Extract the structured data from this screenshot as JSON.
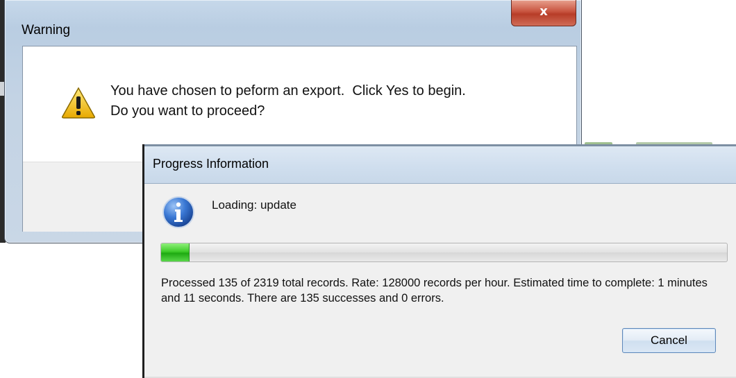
{
  "warning_dialog": {
    "title": "Warning",
    "close_label": "x",
    "message": "You have chosen to peform an export.  Click Yes to begin.\nDo you want to proceed?",
    "icon": "warning-triangle-icon"
  },
  "progress_dialog": {
    "title": "Progress Information",
    "status": "Loading: update",
    "icon": "info-icon",
    "progress_fraction": 0.049,
    "details": "Processed 135 of 2319 total records. Rate: 128000 records per hour. Estimated time to complete: 1 minutes and 11 seconds.  There are 135 successes and 0 errors.",
    "cancel_label": "Cancel"
  },
  "colors": {
    "progress_fill": "#3fcc2a",
    "close_button": "#c8543f",
    "warning_yellow": "#f2c530",
    "info_blue": "#2a5db0"
  }
}
